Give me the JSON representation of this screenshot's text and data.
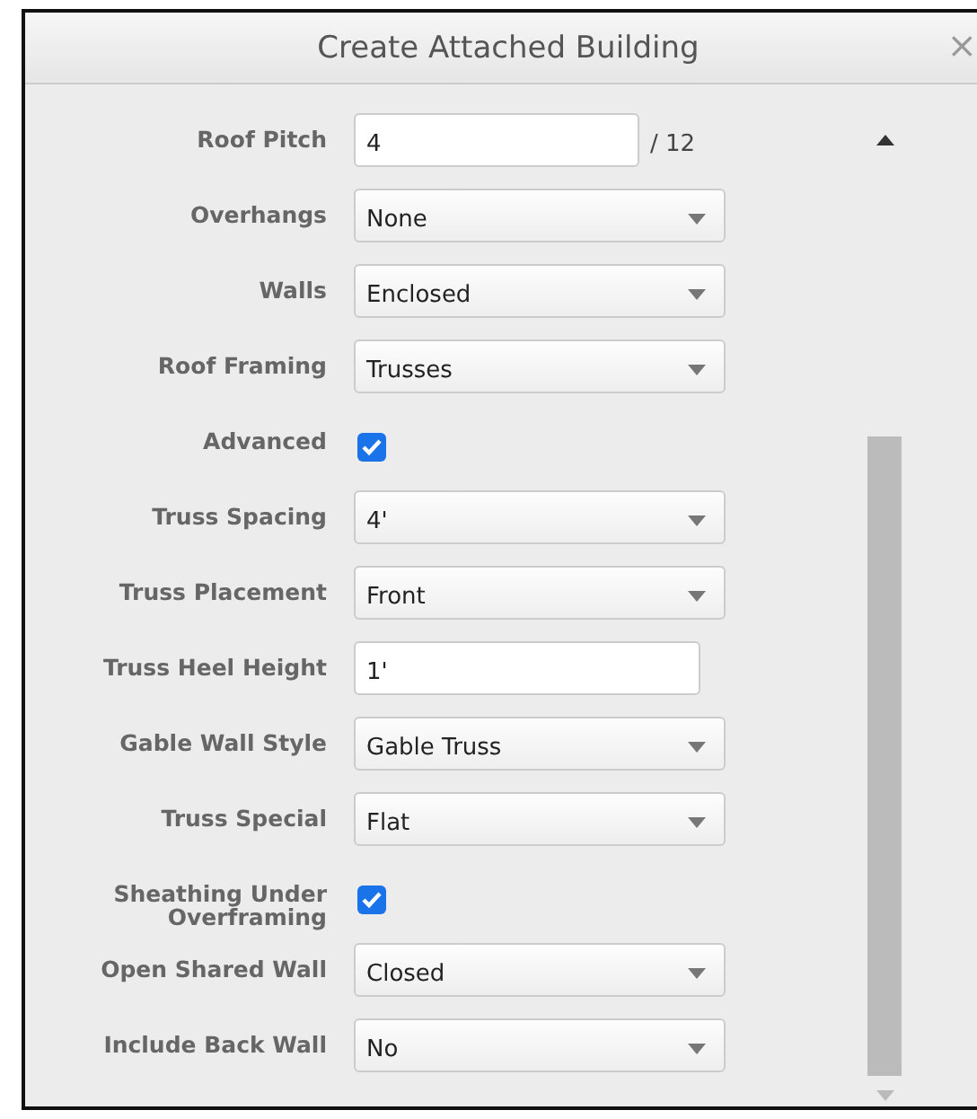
{
  "window": {
    "title": "Create Attached Building",
    "close": "×"
  },
  "fields": [
    {
      "label": "Roof Pitch",
      "kind": "text",
      "value": "4",
      "suffix": "/ 12"
    },
    {
      "label": "Overhangs",
      "kind": "select",
      "value": "None"
    },
    {
      "label": "Walls",
      "kind": "select",
      "value": "Enclosed"
    },
    {
      "label": "Roof Framing",
      "kind": "select",
      "value": "Trusses"
    },
    {
      "label": "Advanced",
      "kind": "checkbox",
      "checked": true
    },
    {
      "label": "Truss Spacing",
      "kind": "select",
      "value": "4'"
    },
    {
      "label": "Truss Placement",
      "kind": "select",
      "value": "Front"
    },
    {
      "label": "Truss Heel Height",
      "kind": "text",
      "value": "1'"
    },
    {
      "label": "Gable Wall Style",
      "kind": "select",
      "value": "Gable Truss"
    },
    {
      "label": "Truss Special",
      "kind": "select",
      "value": "Flat"
    },
    {
      "label": "Sheathing Under Overframing",
      "kind": "checkbox",
      "checked": true
    },
    {
      "label": "Open Shared Wall",
      "kind": "select",
      "value": "Closed"
    },
    {
      "label": "Include Back Wall",
      "kind": "select",
      "value": "No"
    }
  ]
}
